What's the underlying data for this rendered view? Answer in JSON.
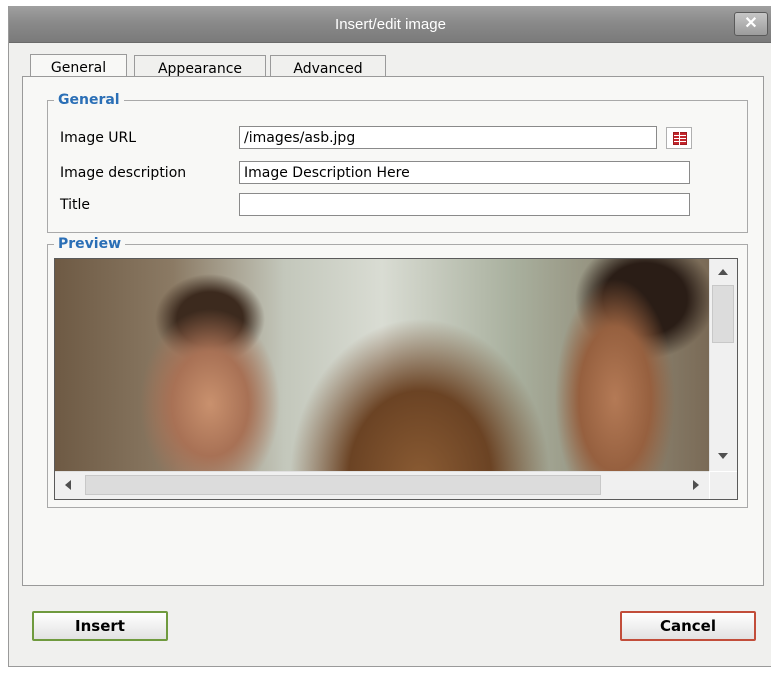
{
  "dialog": {
    "title": "Insert/edit image",
    "close_icon": "close-icon",
    "close_glyph": "✕"
  },
  "tabs": [
    {
      "label": "General",
      "active": true
    },
    {
      "label": "Appearance",
      "active": false
    },
    {
      "label": "Advanced",
      "active": false
    }
  ],
  "general_section": {
    "legend": "General",
    "image_url_label": "Image URL",
    "image_url_value": "/images/asb.jpg",
    "browse_icon": "browse-icon",
    "image_description_label": "Image description",
    "image_description_value": "Image Description Here",
    "title_label": "Title",
    "title_value": ""
  },
  "preview_section": {
    "legend": "Preview"
  },
  "buttons": {
    "insert_label": "Insert",
    "cancel_label": "Cancel"
  },
  "colors": {
    "legend": "#2b6fb6",
    "insert_border": "#6f9a3e",
    "cancel_border": "#c24d3a"
  }
}
